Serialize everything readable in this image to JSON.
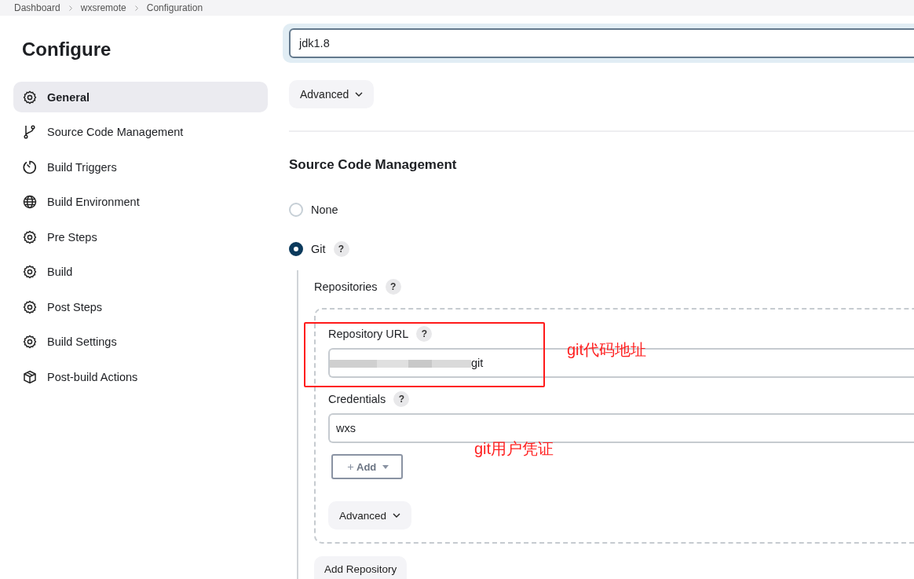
{
  "breadcrumbs": [
    "Dashboard",
    "wxsremote",
    "Configuration"
  ],
  "sidebar": {
    "title": "Configure",
    "items": [
      {
        "label": "General",
        "kind": "gear",
        "selected": true
      },
      {
        "label": "Source Code Management",
        "kind": "branch",
        "selected": false
      },
      {
        "label": "Build Triggers",
        "kind": "timer",
        "selected": false
      },
      {
        "label": "Build Environment",
        "kind": "globe",
        "selected": false
      },
      {
        "label": "Pre Steps",
        "kind": "gear",
        "selected": false
      },
      {
        "label": "Build",
        "kind": "gear",
        "selected": false
      },
      {
        "label": "Post Steps",
        "kind": "gear",
        "selected": false
      },
      {
        "label": "Build Settings",
        "kind": "gear",
        "selected": false
      },
      {
        "label": "Post-build Actions",
        "kind": "box",
        "selected": false
      }
    ]
  },
  "jdk_field": {
    "value": "jdk1.8",
    "focused": true
  },
  "advanced_button": "Advanced",
  "scm": {
    "heading": "Source Code Management",
    "options": [
      {
        "label": "None",
        "selected": false
      },
      {
        "label": "Git",
        "selected": true,
        "help": "?"
      }
    ],
    "repositories": {
      "label": "Repositories",
      "help": "?"
    },
    "repository": {
      "url": {
        "label": "Repository URL",
        "help": "?",
        "value": "git"
      },
      "credentials": {
        "label": "Credentials",
        "help": "?",
        "value": "wxs"
      },
      "add_button": "Add",
      "advanced_button": "Advanced"
    },
    "add_repository": "Add Repository"
  },
  "annotations": [
    {
      "text": "git代码地址"
    },
    {
      "text": "git用户凭证"
    }
  ]
}
